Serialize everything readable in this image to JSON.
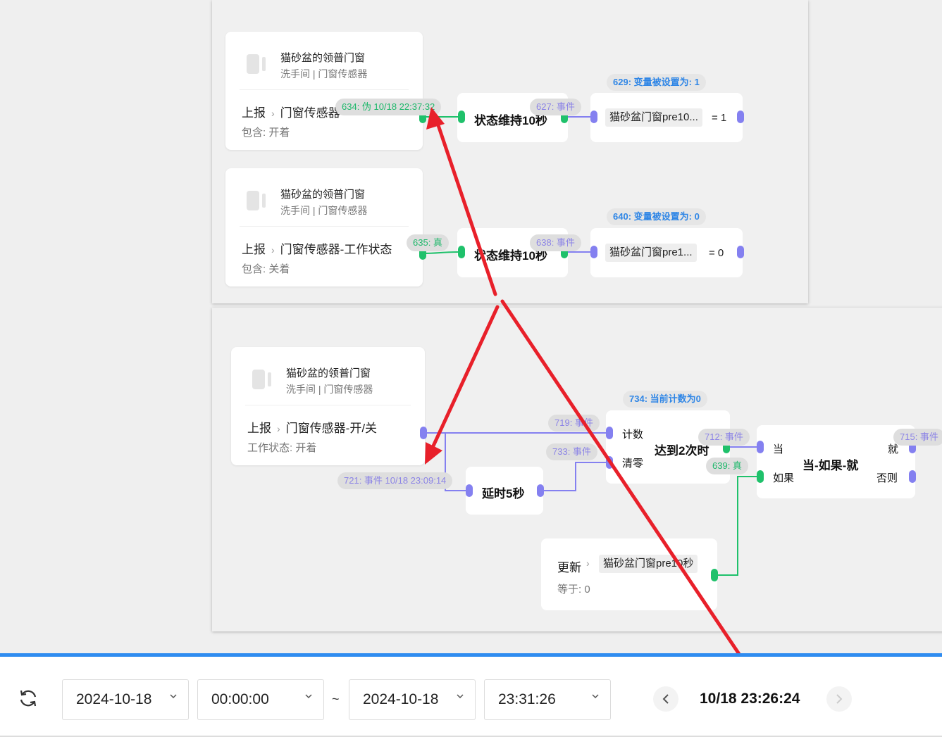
{
  "devices": {
    "name": "猫砂盆的领普门窗",
    "location": "洗手间 | 门窗传感器",
    "report_label": "上报",
    "chevron": "›"
  },
  "flow1": {
    "trigger_a": {
      "event": "门窗传感器",
      "condition": "包含: 开着"
    },
    "trigger_b": {
      "event": "门窗传感器-工作状态",
      "condition": "包含: 关着"
    },
    "hold_node_a": "状态维持10秒",
    "hold_node_b": "状态维持10秒",
    "tag_634": "634: 伪 10/18 22:37:32",
    "tag_635": "635: 真",
    "tag_627": "627: 事件",
    "tag_638": "638: 事件",
    "tag_629": "629: 变量被设置为: 1",
    "tag_640": "640: 变量被设置为: 0",
    "var_a": "猫砂盆门窗pre10...",
    "var_a_eq": "= 1",
    "var_b": "猫砂盆门窗pre1...",
    "var_b_eq": "= 0"
  },
  "flow2": {
    "trigger": {
      "event": "门窗传感器-开/关",
      "condition": "工作状态: 开着"
    },
    "tag_721": "721: 事件 10/18 23:09:14",
    "tag_719": "719: 事件",
    "tag_733": "733: 事件",
    "tag_734": "734: 当前计数为0",
    "tag_712": "712: 事件",
    "tag_639": "639: 真",
    "tag_715": "715: 事件",
    "delay_node": "延时5秒",
    "counter": {
      "title": "达到2次时",
      "count_label": "计数",
      "reset_label": "清零"
    },
    "ifthen": {
      "title": "当-如果-就",
      "when": "当",
      "if": "如果",
      "then": "就",
      "else": "否则"
    },
    "update": {
      "label": "更新",
      "var": "猫砂盆门窗pre10秒",
      "condition": "等于: 0"
    }
  },
  "toolbar": {
    "start_date": "2024-10-18",
    "start_time": "00:00:00",
    "separator": "~",
    "end_date": "2024-10-18",
    "end_time": "23:31:26",
    "current_time": "10/18 23:26:24",
    "refresh_icon": "refresh-icon",
    "accent_color": "#2f8cf0"
  },
  "colors": {
    "green_wire": "#1fc16b",
    "purple_wire": "#8480f0",
    "annotation_arrow": "#e8202a"
  }
}
